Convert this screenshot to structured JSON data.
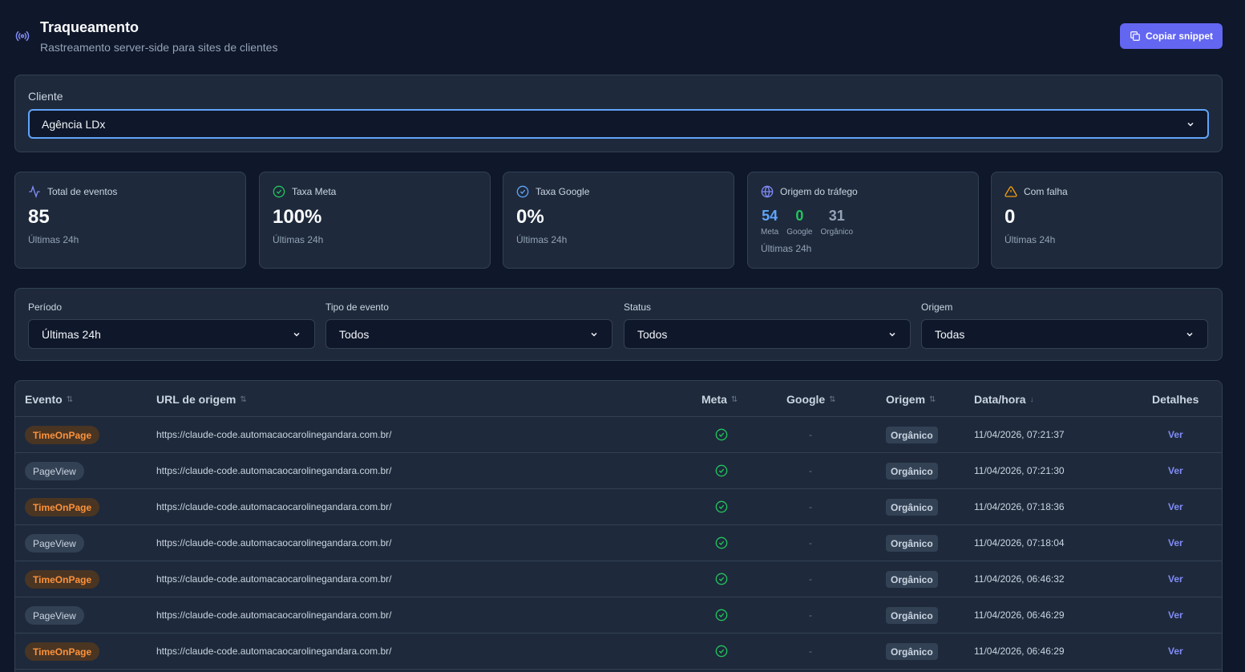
{
  "header": {
    "title": "Traqueamento",
    "subtitle": "Rastreamento server-side para sites de clientes",
    "copy_button": "Copiar snippet"
  },
  "client": {
    "label": "Cliente",
    "selected": "Agência LDx"
  },
  "stats": {
    "total": {
      "label": "Total de eventos",
      "value": "85",
      "sub": "Últimas 24h"
    },
    "meta_rate": {
      "label": "Taxa Meta",
      "value": "100%",
      "sub": "Últimas 24h"
    },
    "google_rate": {
      "label": "Taxa Google",
      "value": "0%",
      "sub": "Últimas 24h"
    },
    "traffic": {
      "label": "Origem do tráfego",
      "meta_value": "54",
      "meta_label": "Meta",
      "google_value": "0",
      "google_label": "Google",
      "organic_value": "31",
      "organic_label": "Orgânico",
      "sub": "Últimas 24h"
    },
    "failed": {
      "label": "Com falha",
      "value": "0",
      "sub": "Últimas 24h"
    }
  },
  "filters": {
    "period": {
      "label": "Período",
      "value": "Últimas 24h"
    },
    "event_type": {
      "label": "Tipo de evento",
      "value": "Todos"
    },
    "status": {
      "label": "Status",
      "value": "Todos"
    },
    "origin": {
      "label": "Origem",
      "value": "Todas"
    }
  },
  "table": {
    "headers": {
      "event": "Evento",
      "url": "URL de origem",
      "meta": "Meta",
      "google": "Google",
      "origin": "Origem",
      "datetime": "Data/hora",
      "details": "Detalhes"
    },
    "sort_icon": "⇅",
    "sort_desc_icon": "↓",
    "rows": [
      {
        "event": "TimeOnPage",
        "url": "https://claude-code.automacaocarolinegandara.com.br/",
        "google": "-",
        "origin": "Orgânico",
        "datetime": "11/04/2026, 07:21:37",
        "action": "Ver"
      },
      {
        "event": "PageView",
        "url": "https://claude-code.automacaocarolinegandara.com.br/",
        "google": "-",
        "origin": "Orgânico",
        "datetime": "11/04/2026, 07:21:30",
        "action": "Ver"
      },
      {
        "event": "TimeOnPage",
        "url": "https://claude-code.automacaocarolinegandara.com.br/",
        "google": "-",
        "origin": "Orgânico",
        "datetime": "11/04/2026, 07:18:36",
        "action": "Ver"
      },
      {
        "event": "PageView",
        "url": "https://claude-code.automacaocarolinegandara.com.br/",
        "google": "-",
        "origin": "Orgânico",
        "datetime": "11/04/2026, 07:18:04",
        "action": "Ver"
      },
      {
        "event": "TimeOnPage",
        "url": "https://claude-code.automacaocarolinegandara.com.br/",
        "google": "-",
        "origin": "Orgânico",
        "datetime": "11/04/2026, 06:46:32",
        "action": "Ver"
      },
      {
        "event": "PageView",
        "url": "https://claude-code.automacaocarolinegandara.com.br/",
        "google": "-",
        "origin": "Orgânico",
        "datetime": "11/04/2026, 06:46:29",
        "action": "Ver"
      },
      {
        "event": "TimeOnPage",
        "url": "https://claude-code.automacaocarolinegandara.com.br/",
        "google": "-",
        "origin": "Orgânico",
        "datetime": "11/04/2026, 06:46:29",
        "action": "Ver"
      }
    ]
  },
  "colors": {
    "accent": "#6366f1",
    "success": "#22c55e",
    "warning": "#f59e0b",
    "meta_blue": "#60a5fa"
  }
}
